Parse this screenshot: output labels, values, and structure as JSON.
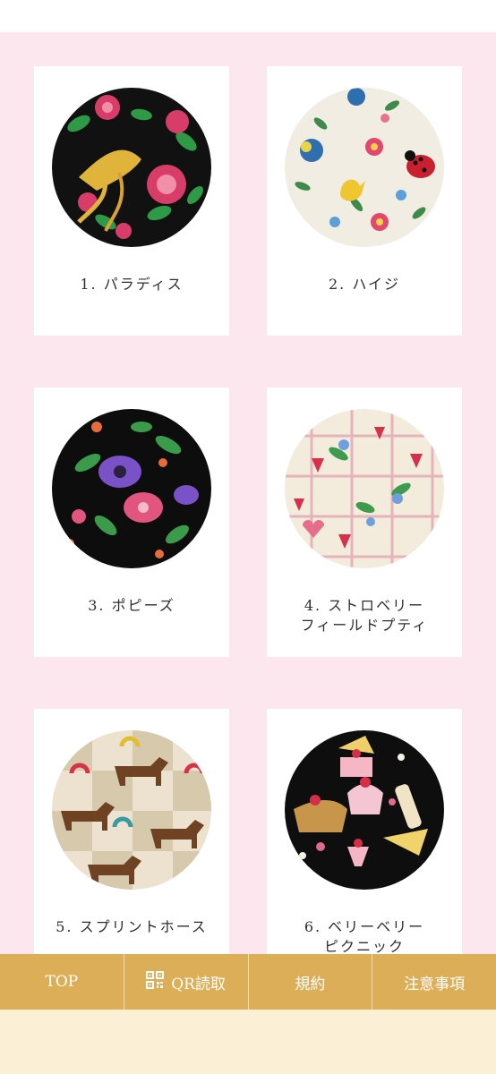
{
  "patterns": [
    {
      "number": "1.",
      "name": "パラディス",
      "name2": ""
    },
    {
      "number": "2.",
      "name": "ハイジ",
      "name2": ""
    },
    {
      "number": "3.",
      "name": "ポピーズ",
      "name2": ""
    },
    {
      "number": "4.",
      "name": "ストロベリー",
      "name2": "フィールドプティ"
    },
    {
      "number": "5.",
      "name": "スプリントホース",
      "name2": ""
    },
    {
      "number": "6.",
      "name": "ベリーベリー",
      "name2": "ピクニック"
    }
  ],
  "nav": {
    "top": "TOP",
    "qr": "QR読取",
    "terms": "規約",
    "notes": "注意事項"
  },
  "colors": {
    "page_bg": "#fce7ee",
    "nav_bg": "#dcae58",
    "footer_bg": "#fbefd6"
  },
  "icons": [
    "qr-code-icon"
  ]
}
